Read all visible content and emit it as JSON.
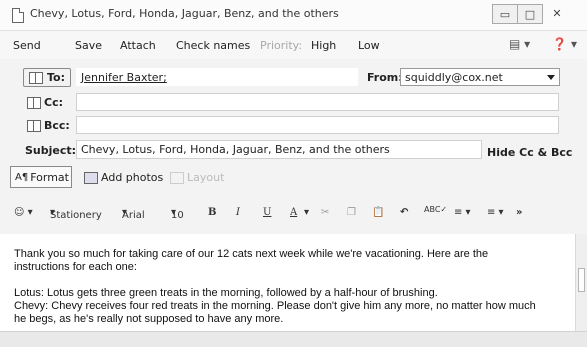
{
  "window": {
    "title": "Chevy, Lotus, Ford, Honda, Jaguar, Benz, and the others"
  },
  "toolbar": {
    "send": "Send",
    "save": "Save",
    "attach": "Attach",
    "check_names": "Check names",
    "priority": "Priority:",
    "high": "High",
    "low": "Low"
  },
  "header": {
    "to_label": "To:",
    "to_value": "Jennifer Baxter;",
    "from_label": "From:",
    "from_value": "squiddly@cox.net",
    "cc_label": "Cc:",
    "bcc_label": "Bcc:",
    "subject_label": "Subject:",
    "subject_value": "Chevy, Lotus, Ford, Honda, Jaguar, Benz, and the others",
    "hide_cc_bcc": "Hide Cc & Bcc"
  },
  "actions": {
    "format": "Format",
    "add_photos": "Add photos",
    "layout": "Layout"
  },
  "formatting": {
    "stationery": "Stationery",
    "font": "Arial",
    "size": "10",
    "bold": "B",
    "italic": "I",
    "underline": "U",
    "font_color": "A",
    "more": "»"
  },
  "message": {
    "line1": "Thank you so much for taking care of our 12 cats next week while we're vacationing. Here are the",
    "line2": "instructions for each one:",
    "line3": "Lotus: Lotus gets three green treats in the morning, followed by a half-hour of brushing.",
    "line4": "Chevy: Chevy receives four red treats in the morning. Please don't give him any more, no matter how much",
    "line5": "he begs, as he's really not supposed to have any more."
  }
}
